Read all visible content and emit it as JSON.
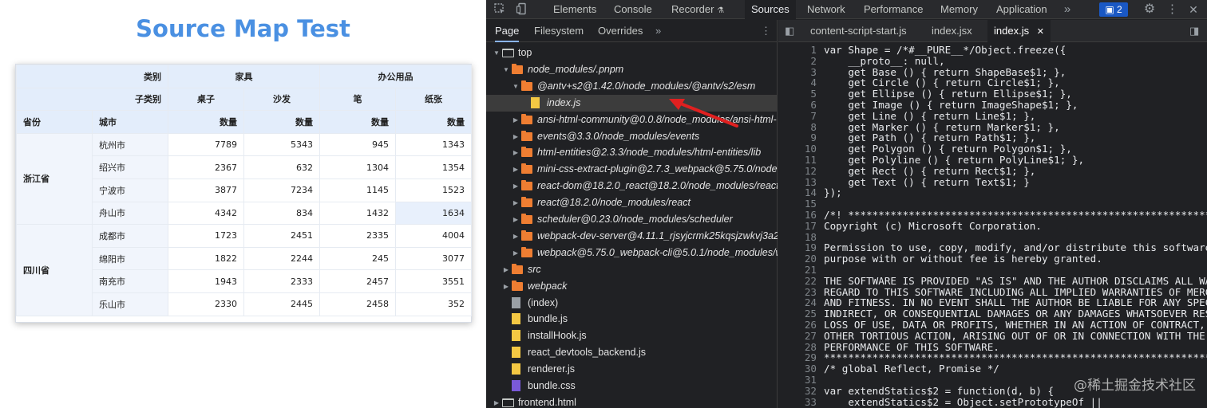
{
  "left_page": {
    "title": "Source Map Test",
    "table": {
      "header_row1": [
        "类别",
        "家具",
        "办公用品"
      ],
      "header_row2": [
        "子类别",
        "桌子",
        "沙发",
        "笔",
        "纸张"
      ],
      "header_row3": [
        "省份",
        "城市",
        "数量",
        "数量",
        "数量",
        "数量"
      ],
      "provinces": [
        {
          "name": "浙江省",
          "cities": [
            {
              "city": "杭州市",
              "values": [
                "7789",
                "5343",
                "945",
                "1343"
              ]
            },
            {
              "city": "绍兴市",
              "values": [
                "2367",
                "632",
                "1304",
                "1354"
              ]
            },
            {
              "city": "宁波市",
              "values": [
                "3877",
                "7234",
                "1145",
                "1523"
              ]
            },
            {
              "city": "舟山市",
              "values": [
                "4342",
                "834",
                "1432",
                "1634"
              ]
            }
          ]
        },
        {
          "name": "四川省",
          "cities": [
            {
              "city": "成都市",
              "values": [
                "1723",
                "2451",
                "2335",
                "4004"
              ]
            },
            {
              "city": "绵阳市",
              "values": [
                "1822",
                "2244",
                "245",
                "3077"
              ]
            },
            {
              "city": "南充市",
              "values": [
                "1943",
                "2333",
                "2457",
                "3551"
              ]
            },
            {
              "city": "乐山市",
              "values": [
                "2330",
                "2445",
                "2458",
                "352"
              ]
            }
          ]
        }
      ]
    }
  },
  "devtools": {
    "toolbar_tabs": [
      "Elements",
      "Console",
      "Recorder",
      "Sources",
      "Network",
      "Performance",
      "Memory",
      "Application"
    ],
    "active_tab": "Sources",
    "issues_count": "2",
    "left_tabs": [
      "Page",
      "Filesystem",
      "Overrides"
    ],
    "tree": [
      {
        "label": "top",
        "italic": false,
        "icon": "frame"
      },
      {
        "label": "node_modules/.pnpm",
        "italic": true,
        "icon": "folder"
      },
      {
        "label": "@antv+s2@1.42.0/node_modules/@antv/s2/esm",
        "italic": true,
        "icon": "folder"
      },
      {
        "label": "index.js",
        "italic": true,
        "icon": "file-yellow"
      },
      {
        "label": "ansi-html-community@0.0.8/node_modules/ansi-html-",
        "italic": true,
        "icon": "folder"
      },
      {
        "label": "events@3.3.0/node_modules/events",
        "italic": true,
        "icon": "folder"
      },
      {
        "label": "html-entities@2.3.3/node_modules/html-entities/lib",
        "italic": true,
        "icon": "folder"
      },
      {
        "label": "mini-css-extract-plugin@2.7.3_webpack@5.75.0/node",
        "italic": true,
        "icon": "folder"
      },
      {
        "label": "react-dom@18.2.0_react@18.2.0/node_modules/react",
        "italic": true,
        "icon": "folder"
      },
      {
        "label": "react@18.2.0/node_modules/react",
        "italic": true,
        "icon": "folder"
      },
      {
        "label": "scheduler@0.23.0/node_modules/scheduler",
        "italic": true,
        "icon": "folder"
      },
      {
        "label": "webpack-dev-server@4.11.1_rjsyjcrmk25kqsjzwkvj3a2",
        "italic": true,
        "icon": "folder"
      },
      {
        "label": "webpack@5.75.0_webpack-cli@5.0.1/node_modules/w",
        "italic": true,
        "icon": "folder"
      },
      {
        "label": "src",
        "italic": true,
        "icon": "folder"
      },
      {
        "label": "webpack",
        "italic": true,
        "icon": "folder"
      },
      {
        "label": "(index)",
        "italic": false,
        "icon": "file-gray"
      },
      {
        "label": "bundle.js",
        "italic": false,
        "icon": "file-yellow"
      },
      {
        "label": "installHook.js",
        "italic": false,
        "icon": "file-yellow"
      },
      {
        "label": "react_devtools_backend.js",
        "italic": false,
        "icon": "file-yellow"
      },
      {
        "label": "renderer.js",
        "italic": false,
        "icon": "file-yellow"
      },
      {
        "label": "bundle.css",
        "italic": false,
        "icon": "file-purple"
      },
      {
        "label": "frontend.html",
        "italic": false,
        "icon": "frame"
      }
    ],
    "file_tabs": [
      "content-script-start.js",
      "index.jsx",
      "index.js"
    ],
    "active_file": "index.js",
    "code_lines": [
      "var Shape = /*#__PURE__*/Object.freeze({",
      "    __proto__: null,",
      "    get Base () { return ShapeBase$1; },",
      "    get Circle () { return Circle$1; },",
      "    get Ellipse () { return Ellipse$1; },",
      "    get Image () { return ImageShape$1; },",
      "    get Line () { return Line$1; },",
      "    get Marker () { return Marker$1; },",
      "    get Path () { return Path$1; },",
      "    get Polygon () { return Polygon$1; },",
      "    get Polyline () { return PolyLine$1; },",
      "    get Rect () { return Rect$1; },",
      "    get Text () { return Text$1; }",
      "});",
      "",
      "/*! *****************************************************************************",
      "Copyright (c) Microsoft Corporation.",
      "",
      "Permission to use, copy, modify, and/or distribute this software for any",
      "purpose with or without fee is hereby granted.",
      "",
      "THE SOFTWARE IS PROVIDED \"AS IS\" AND THE AUTHOR DISCLAIMS ALL WARRANTIES WITH",
      "REGARD TO THIS SOFTWARE INCLUDING ALL IMPLIED WARRANTIES OF MERCHANTABILITY",
      "AND FITNESS. IN NO EVENT SHALL THE AUTHOR BE LIABLE FOR ANY SPECIAL, DIRECT,",
      "INDIRECT, OR CONSEQUENTIAL DAMAGES OR ANY DAMAGES WHATSOEVER RESULTING FROM",
      "LOSS OF USE, DATA OR PROFITS, WHETHER IN AN ACTION OF CONTRACT, NEGLIGENCE OR",
      "OTHER TORTIOUS ACTION, ARISING OUT OF OR IN CONNECTION WITH THE USE OR",
      "PERFORMANCE OF THIS SOFTWARE.",
      "***************************************************************************** */",
      "/* global Reflect, Promise */",
      "",
      "var extendStatics$2 = function(d, b) {",
      "    extendStatics$2 = Object.setPrototypeOf ||"
    ]
  },
  "watermark": "@稀土掘金技术社区",
  "colors": {
    "title_blue": "#4a90e2",
    "header_bg": "#e3edfb",
    "folder_orange": "#ef7e32",
    "arrow_red": "#e02020"
  }
}
